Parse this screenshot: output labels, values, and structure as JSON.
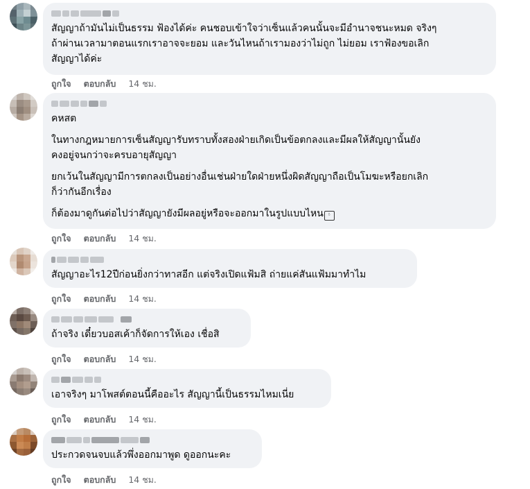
{
  "comments": [
    {
      "paragraphs": [
        "สัญญาถ้ามันไม่เป็นธรรม ฟ้องได้ค่ะ คนชอบเข้าใจว่าเซ็นแล้วคนนั้นจะมีอำนาจชนะหมด จริงๆ\nถ้าผ่านเวลามาตอนแรกเราอาจจะยอม และวันไหนถ้าเรามองว่าไม่ถูก ไม่ยอม เราฟ้องขอเลิก\nสัญญาได้ค่ะ"
      ],
      "like": "ถูกใจ",
      "reply": "ตอบกลับ",
      "time": "14 ชม."
    },
    {
      "paragraphs": [
        "คหสต",
        "ในทางกฎหมายการเซ็นสัญญารับทราบทั้งสองฝ่ายเกิดเป็นข้อตกลงและมีผลให้สัญญานั้นยัง\nคงอยู่จนกว่าจะครบอายุสัญญา",
        "ยกเว้นในสัญญามีการตกลงเป็นอย่างอื่นเช่นฝ่ายใดฝ่ายหนึ่งผิดสัญญาถือเป็นโมฆะหรือยกเลิก\nก็ว่ากันอีกเรื่อง",
        "ก็ต้องมาดูกันต่อไปว่าสัญญายังมีผลอยู่หรือจะออกมาในรูปแบบไหน"
      ],
      "emoji": "ㅤ",
      "like": "ถูกใจ",
      "reply": "ตอบกลับ",
      "time": "14 ชม."
    },
    {
      "paragraphs": [
        "สัญญาอะไร12ปีก่อนยิ่งกว่าทาสอีก แต่จริงเปิดแฟ้มสิ ถ่ายแค่สันแฟ้มมาทำไม"
      ],
      "like": "ถูกใจ",
      "reply": "ตอบกลับ",
      "time": "14 ชม."
    },
    {
      "paragraphs": [
        "ถ้าจริง เดี๋ยวบอสเค้าก็จัดการให้เอง เชื่อสิ"
      ],
      "like": "ถูกใจ",
      "reply": "ตอบกลับ",
      "time": "14 ชม."
    },
    {
      "paragraphs": [
        "เอาจริงๆ มาโพสต์ตอนนี้คืออะไร สัญญานี้เป็นธรรมไหมเนี่ย"
      ],
      "like": "ถูกใจ",
      "reply": "ตอบกลับ",
      "time": "14 ชม."
    },
    {
      "paragraphs": [
        "ประกวดจนจบแล้วพึ่งออกมาพูด ดูออกนะคะ"
      ],
      "like": "ถูกใจ",
      "reply": "ตอบกลับ",
      "time": "14 ชม."
    }
  ],
  "colors": {
    "bubble": "#f0f2f5",
    "meta": "#65676b",
    "text": "#050505"
  }
}
